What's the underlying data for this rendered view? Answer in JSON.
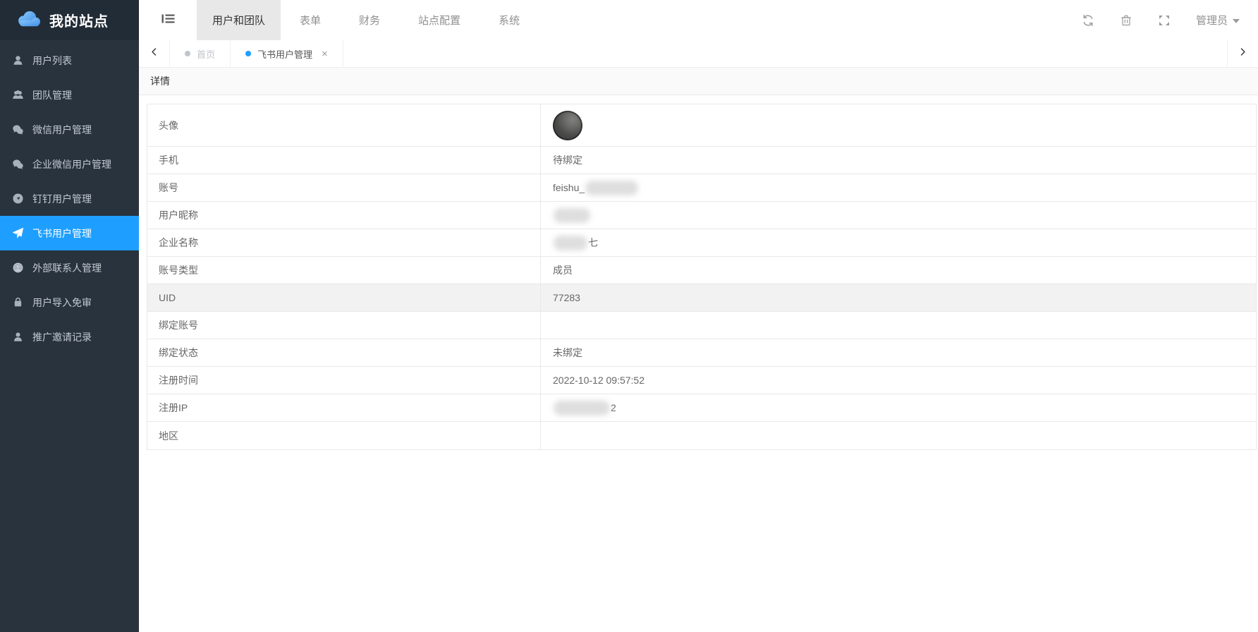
{
  "brand": {
    "name": "我的站点",
    "logo_icon": "cloud-icon"
  },
  "sidebar": {
    "items": [
      {
        "id": "user-list",
        "label": "用户列表",
        "icon": "user-icon",
        "active": false
      },
      {
        "id": "team-management",
        "label": "团队管理",
        "icon": "users-icon",
        "active": false
      },
      {
        "id": "wechat-users",
        "label": "微信用户管理",
        "icon": "wechat-icon",
        "active": false
      },
      {
        "id": "wework-users",
        "label": "企业微信用户管理",
        "icon": "wework-icon",
        "active": false
      },
      {
        "id": "dingtalk-users",
        "label": "钉钉用户管理",
        "icon": "dingtalk-icon",
        "active": false
      },
      {
        "id": "feishu-users",
        "label": "飞书用户管理",
        "icon": "feishu-icon",
        "active": true
      },
      {
        "id": "external-contacts",
        "label": "外部联系人管理",
        "icon": "external-contact-icon",
        "active": false
      },
      {
        "id": "user-import",
        "label": "用户导入免审",
        "icon": "lock-icon",
        "active": false
      },
      {
        "id": "invite-records",
        "label": "推广邀请记录",
        "icon": "person-outline-icon",
        "active": false
      }
    ]
  },
  "topnav": {
    "tabs": [
      {
        "id": "users-teams",
        "label": "用户和团队",
        "active": true
      },
      {
        "id": "forms",
        "label": "表单",
        "active": false
      },
      {
        "id": "finance",
        "label": "财务",
        "active": false
      },
      {
        "id": "site-config",
        "label": "站点配置",
        "active": false
      },
      {
        "id": "system",
        "label": "系统",
        "active": false
      }
    ],
    "actions": [
      {
        "id": "refresh",
        "icon": "refresh-icon"
      },
      {
        "id": "clear",
        "icon": "trash-icon"
      },
      {
        "id": "fullscreen",
        "icon": "fullscreen-icon"
      }
    ],
    "admin_label": "管理员"
  },
  "tabbar": {
    "tabs": [
      {
        "id": "home",
        "label": "首页",
        "dot_color": "#c2c6cc",
        "active": false,
        "closable": false
      },
      {
        "id": "feishu-users",
        "label": "飞书用户管理",
        "dot_color": "#1e9fff",
        "active": true,
        "closable": true
      }
    ],
    "close_glyph": "×"
  },
  "panel": {
    "title": "详情"
  },
  "detail": {
    "rows": [
      {
        "label": "头像",
        "type": "avatar"
      },
      {
        "label": "手机",
        "value": "待绑定"
      },
      {
        "label": "账号",
        "value": "feishu_",
        "blur_width": 75
      },
      {
        "label": "用户昵称",
        "value": "",
        "blur_width": 52
      },
      {
        "label": "企业名称",
        "value": "",
        "blur_width": 48,
        "suffix": "七"
      },
      {
        "label": "账号类型",
        "value": "成员"
      },
      {
        "label": "UID",
        "value": "77283",
        "highlight": true
      },
      {
        "label": "绑定账号",
        "value": ""
      },
      {
        "label": "绑定状态",
        "value": "未绑定"
      },
      {
        "label": "注册时间",
        "value": "2022-10-12 09:57:52"
      },
      {
        "label": "注册IP",
        "value": "",
        "blur_width": 80,
        "suffix": "2"
      },
      {
        "label": "地区",
        "value": ""
      }
    ]
  },
  "colors": {
    "accent": "#1e9fff",
    "sidebar_bg": "#28333e",
    "logo_bg": "#222c36",
    "active_nav_bg": "#e8e8e8",
    "row_highlight": "#f2f2f2",
    "border": "#e8e8e8",
    "inactive_dot": "#c2c6cc"
  }
}
